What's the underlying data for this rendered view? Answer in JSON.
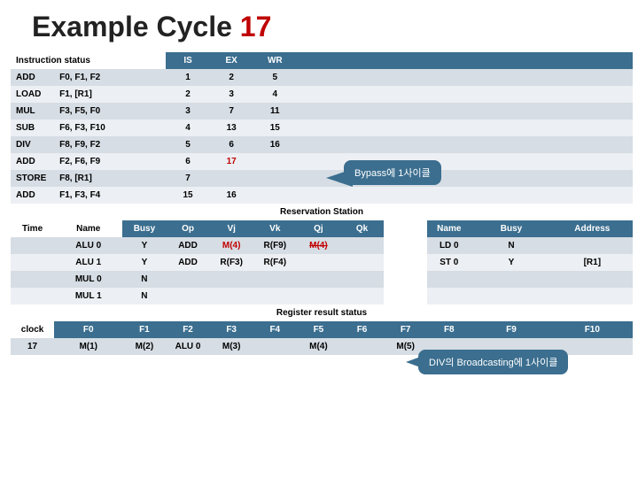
{
  "title_main": "Example Cycle ",
  "title_num": "17",
  "instr_hdr": {
    "lead": "Instruction status",
    "is": "IS",
    "ex": "EX",
    "wr": "WR"
  },
  "instr_rows": [
    {
      "op": "ADD",
      "args": "F0, F1, F2",
      "is": "1",
      "ex": "2",
      "wr": "5"
    },
    {
      "op": "LOAD",
      "args": "F1, [R1]",
      "is": "2",
      "ex": "3",
      "wr": "4"
    },
    {
      "op": "MUL",
      "args": "F3, F5, F0",
      "is": "3",
      "ex": "7",
      "wr": "11"
    },
    {
      "op": "SUB",
      "args": "F6, F3, F10",
      "is": "4",
      "ex": "13",
      "wr": "15"
    },
    {
      "op": "DIV",
      "args": "F8, F9, F2",
      "is": "5",
      "ex": "6",
      "wr": "16"
    },
    {
      "op": "ADD",
      "args": "F2, F6, F9",
      "is": "6",
      "ex": "17",
      "ex_red": true,
      "wr": ""
    },
    {
      "op": "STORE",
      "args": "F8, [R1]",
      "is": "7",
      "ex": "",
      "wr": ""
    },
    {
      "op": "ADD",
      "args": "F1, F3, F4",
      "is": "15",
      "ex": "16",
      "wr": ""
    }
  ],
  "rs_section": "Reservation Station",
  "rs_hdr": {
    "time": "Time",
    "name": "Name",
    "busy": "Busy",
    "op": "Op",
    "vj": "Vj",
    "vk": "Vk",
    "qj": "Qj",
    "qk": "Qk",
    "name2": "Name",
    "busy2": "Busy",
    "addr": "Address"
  },
  "rs_rows": [
    {
      "time": "",
      "name": "ALU 0",
      "busy": "Y",
      "op": "ADD",
      "vj": "M(4)",
      "vj_red": true,
      "vk": "R(F9)",
      "qj": "M(4)",
      "qj_strike": true,
      "qk": "",
      "name2": "LD 0",
      "busy2": "N",
      "addr": ""
    },
    {
      "time": "",
      "name": "ALU 1",
      "busy": "Y",
      "op": "ADD",
      "vj": "R(F3)",
      "vk": "R(F4)",
      "qj": "",
      "qk": "",
      "name2": "ST 0",
      "busy2": "Y",
      "addr": "[R1]"
    },
    {
      "time": "",
      "name": "MUL 0",
      "busy": "N",
      "op": "",
      "vj": "",
      "vk": "",
      "qj": "",
      "qk": "",
      "name2": "",
      "busy2": "",
      "addr": ""
    },
    {
      "time": "",
      "name": "MUL 1",
      "busy": "N",
      "op": "",
      "vj": "",
      "vk": "",
      "qj": "",
      "qk": "",
      "name2": "",
      "busy2": "",
      "addr": ""
    }
  ],
  "reg_section": "Register result status",
  "reg_hdr": [
    "clock",
    "F0",
    "F1",
    "F2",
    "F3",
    "F4",
    "F5",
    "F6",
    "F7",
    "F8",
    "F9",
    "F10"
  ],
  "reg_row": [
    "17",
    "M(1)",
    "M(2)",
    "ALU 0",
    "M(3)",
    "",
    "M(4)",
    "",
    "M(5)",
    "",
    "",
    ""
  ],
  "callout1": "Bypass에 1사이클",
  "callout2": "DIV의 Broadcasting에 1사이클"
}
